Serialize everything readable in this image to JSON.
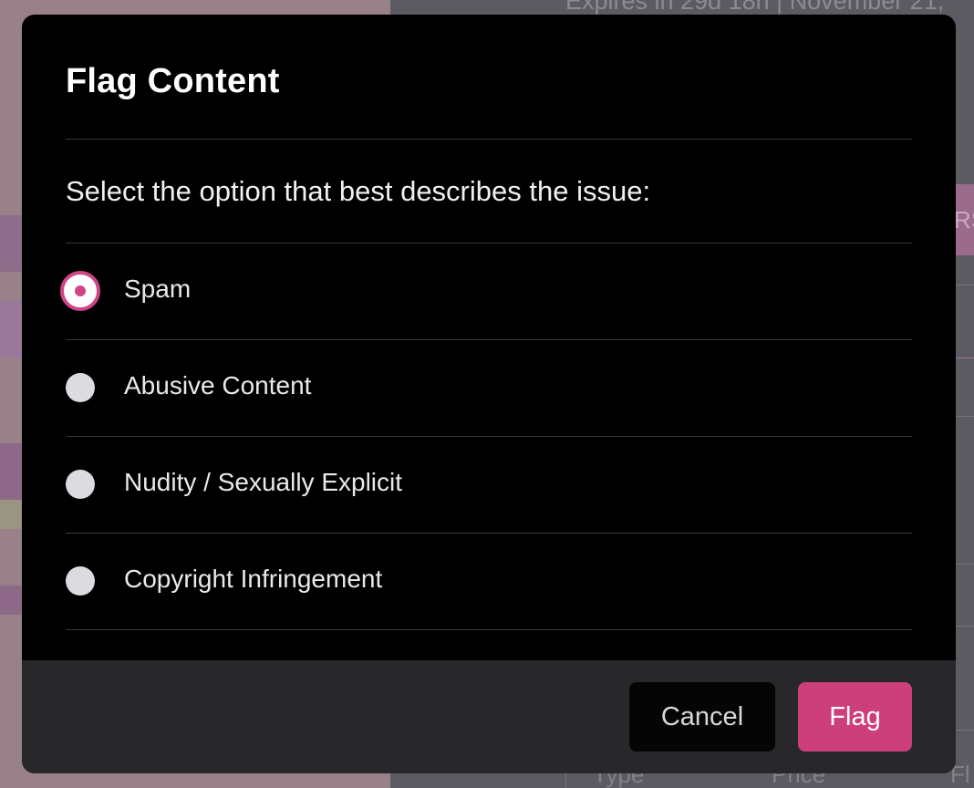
{
  "background": {
    "expires_text": "Expires in 29d 18h | November 21,",
    "tag_text": "RS",
    "footer_columns": [
      "Type",
      "Price",
      "Fl"
    ]
  },
  "modal": {
    "title": "Flag Content",
    "prompt": "Select the option that best describes the issue:",
    "options": [
      {
        "label": "Spam",
        "selected": true
      },
      {
        "label": "Abusive Content",
        "selected": false
      },
      {
        "label": "Nudity / Sexually Explicit",
        "selected": false
      },
      {
        "label": "Copyright Infringement",
        "selected": false
      }
    ],
    "cancel_label": "Cancel",
    "flag_label": "Flag"
  },
  "colors": {
    "accent": "#d14587",
    "flag_button": "#cd3f7a",
    "modal_bg": "#000000",
    "footer_bg": "#28282b"
  }
}
